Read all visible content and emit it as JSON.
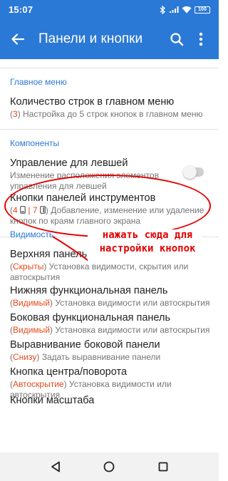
{
  "status": {
    "time": "15:07",
    "battery": "100"
  },
  "app_bar": {
    "title": "Панели и кнопки"
  },
  "sections": {
    "main_menu": {
      "header": "Главное меню"
    },
    "components": {
      "header": "Компоненты"
    },
    "visibility": {
      "header": "Видимость"
    }
  },
  "items": {
    "rows_count": {
      "title": "Количество строк в главном меню",
      "value": "3",
      "desc": " Настройка до 5 строк кнопок в главном меню"
    },
    "left_handed": {
      "title": "Управление для левшей",
      "desc": "Изменение расположения элементов управления для левшей",
      "toggle_on": false
    },
    "toolbar_buttons": {
      "title": "Кнопки панелей инструментов",
      "v1": "4",
      "v2": "7",
      "desc": " Добавление, изменение или удаление кнопок по краям главного экрана"
    },
    "top_panel": {
      "title": "Верхняя панель",
      "value": "Скрыты",
      "desc": " Установка видимости, скрытия или автоскрытия"
    },
    "bottom_panel": {
      "title": "Нижняя функциональная панель",
      "value": "Видимый",
      "desc": " Установка видимости или автоскрытия"
    },
    "side_panel": {
      "title": "Боковая функциональная панель",
      "value": "Видимый",
      "desc": " Установка видимости или автоскрытия"
    },
    "side_align": {
      "title": "Выравнивание боковой панели",
      "value": "Снизу",
      "desc": " Задать выравнивание панели"
    },
    "center_button": {
      "title": "Кнопка центра/поворота",
      "value": "Автоскрытие",
      "desc": " Установка видимости или автоскрытия"
    },
    "zoom_buttons": {
      "title": "Кнопки масштаба"
    }
  },
  "annotation": {
    "line1": "нажать сюда для",
    "line2": "настройки кнопок"
  },
  "colors": {
    "accent": "#2b79d6",
    "highlight": "#e64a19",
    "annotation": "#e40000"
  }
}
